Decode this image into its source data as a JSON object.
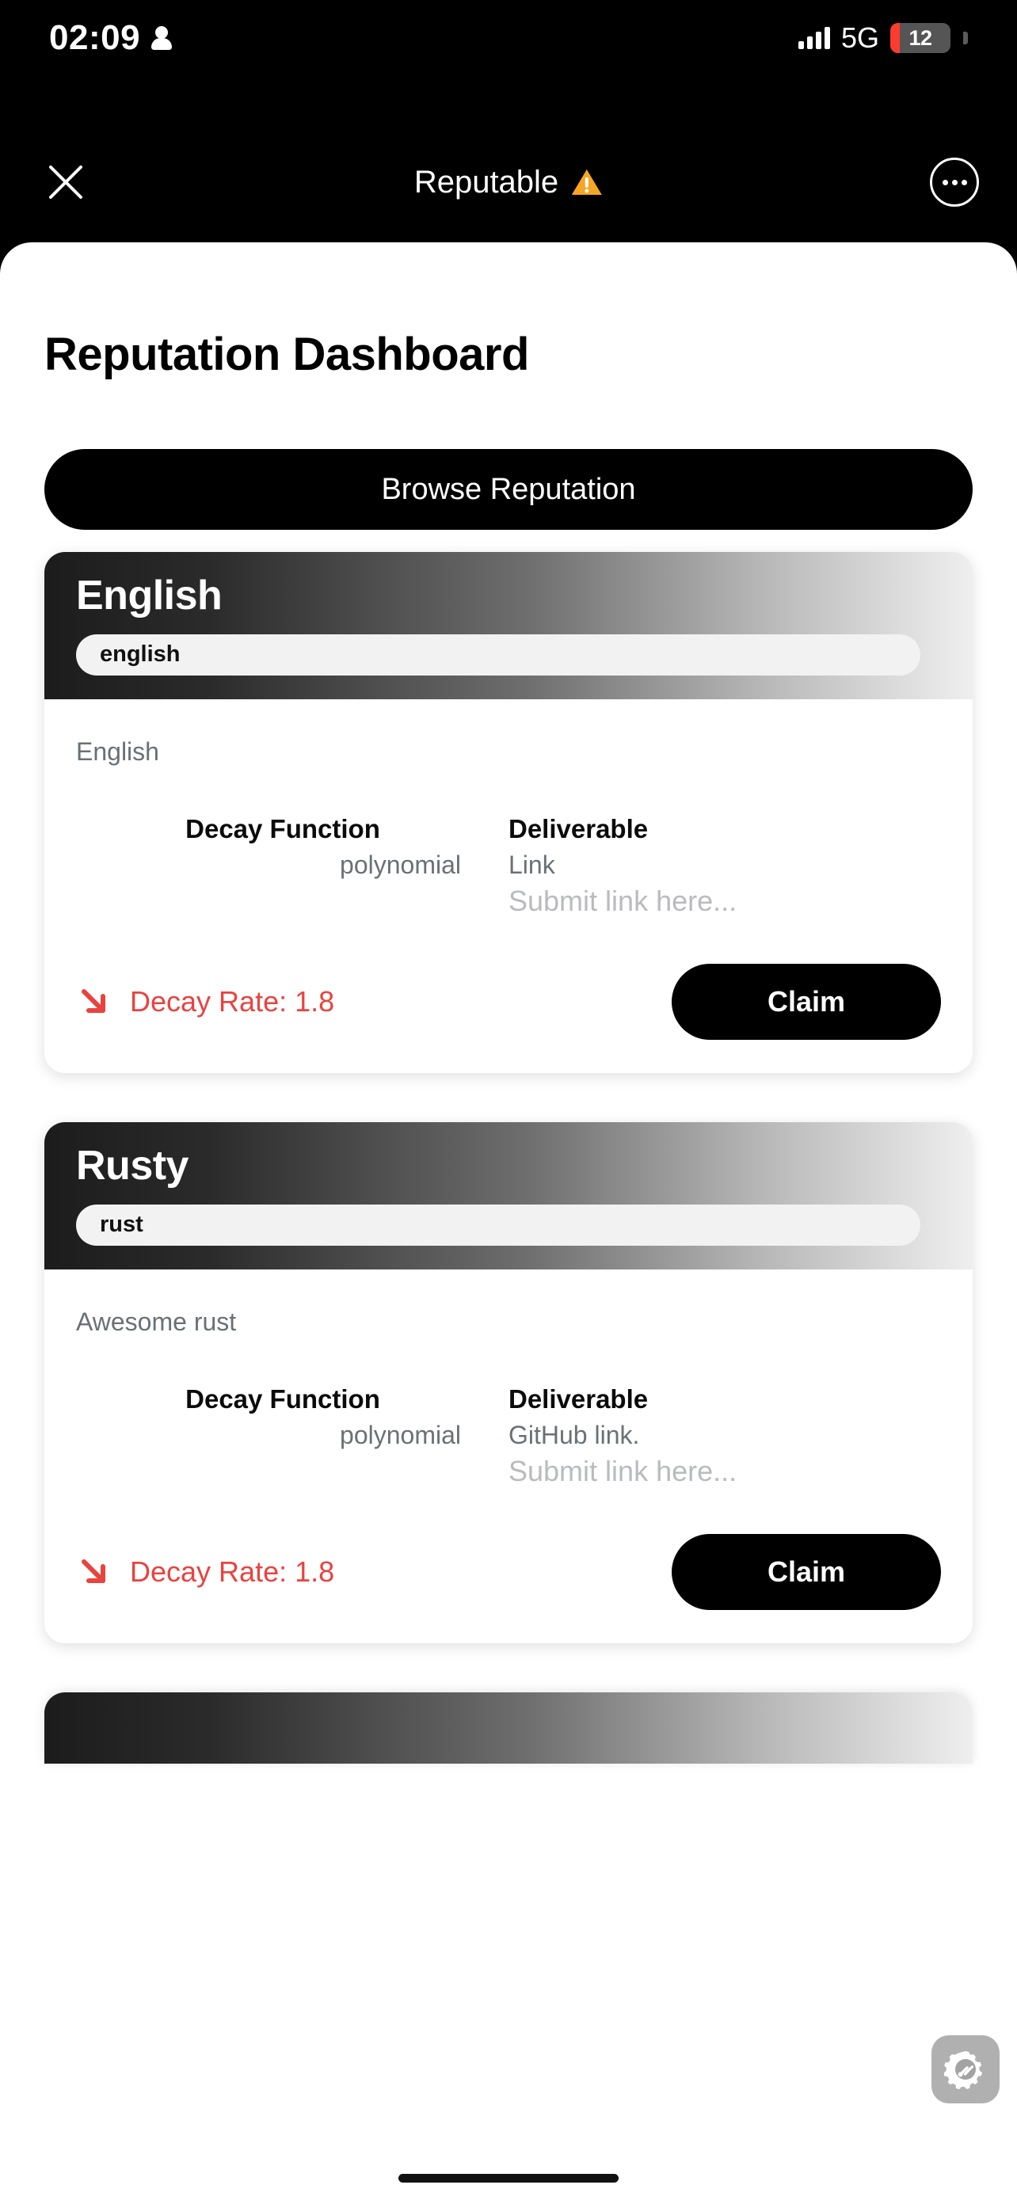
{
  "status_bar": {
    "time": "02:09",
    "person_icon": "person-icon",
    "signal_icon": "signal-bars-icon",
    "network": "5G",
    "battery_level": "12",
    "battery_color": "#ff3b30"
  },
  "nav_bar": {
    "close_icon": "close-icon",
    "title": "Reputable",
    "warning_icon": "warning-triangle-icon",
    "warning_color": "#f5a623",
    "more_icon": "more-options-icon"
  },
  "page": {
    "title": "Reputation Dashboard",
    "browse_button": "Browse Reputation"
  },
  "labels": {
    "decay_function": "Decay Function",
    "deliverable": "Deliverable",
    "decay_arrow_icon": "arrow-down-right-icon",
    "claim": "Claim",
    "decay_rate_color": "#e8433f"
  },
  "cards": [
    {
      "title": "English",
      "tag": "english",
      "description": "English",
      "decay_function_label": "Decay Function",
      "decay_function_value": "polynomial",
      "deliverable_label": "Deliverable",
      "deliverable_value": "Link",
      "deliverable_placeholder": "Submit link here...",
      "decay_rate": "Decay Rate: 1.8",
      "claim_label": "Claim"
    },
    {
      "title": "Rusty",
      "tag": "rust",
      "description": "Awesome rust",
      "decay_function_label": "Decay Function",
      "decay_function_value": "polynomial",
      "deliverable_label": "Deliverable",
      "deliverable_value": "GitHub link.",
      "deliverable_placeholder": "Submit link here...",
      "decay_rate": "Decay Rate: 1.8",
      "claim_label": "Claim"
    }
  ],
  "fab": {
    "icon": "settings-gear-tools-icon"
  }
}
